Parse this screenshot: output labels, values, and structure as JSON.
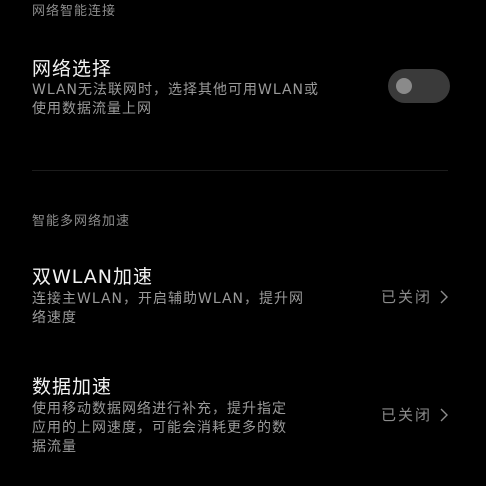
{
  "sections": {
    "network_smart": {
      "header": "网络智能连接"
    },
    "multi_network": {
      "header": "智能多网络加速"
    }
  },
  "network_select": {
    "title": "网络选择",
    "description_line1": "WLAN无法联网时，选择其他可用WLAN或",
    "description_line2": "使用数据流量上网",
    "toggle_state": "off"
  },
  "dual_wlan": {
    "title": "双WLAN加速",
    "description_line1": "连接主WLAN，开启辅助WLAN，提升网",
    "description_line2": "络速度",
    "value": "已关闭",
    "chevron_icon": "chevron-right-icon"
  },
  "data_accel": {
    "title": "数据加速",
    "description_line1": "使用移动数据网络进行补充，提升指定",
    "description_line2": "应用的上网速度，可能会消耗更多的数",
    "description_line3": "据流量",
    "value": "已关闭",
    "chevron_icon": "chevron-right-icon"
  },
  "colors": {
    "background": "#000000",
    "title_text": "#f2f2f2",
    "secondary_text": "#9a9a9a",
    "toggle_track_off": "#3a3a3a",
    "toggle_knob_off": "#8a8a8a"
  }
}
